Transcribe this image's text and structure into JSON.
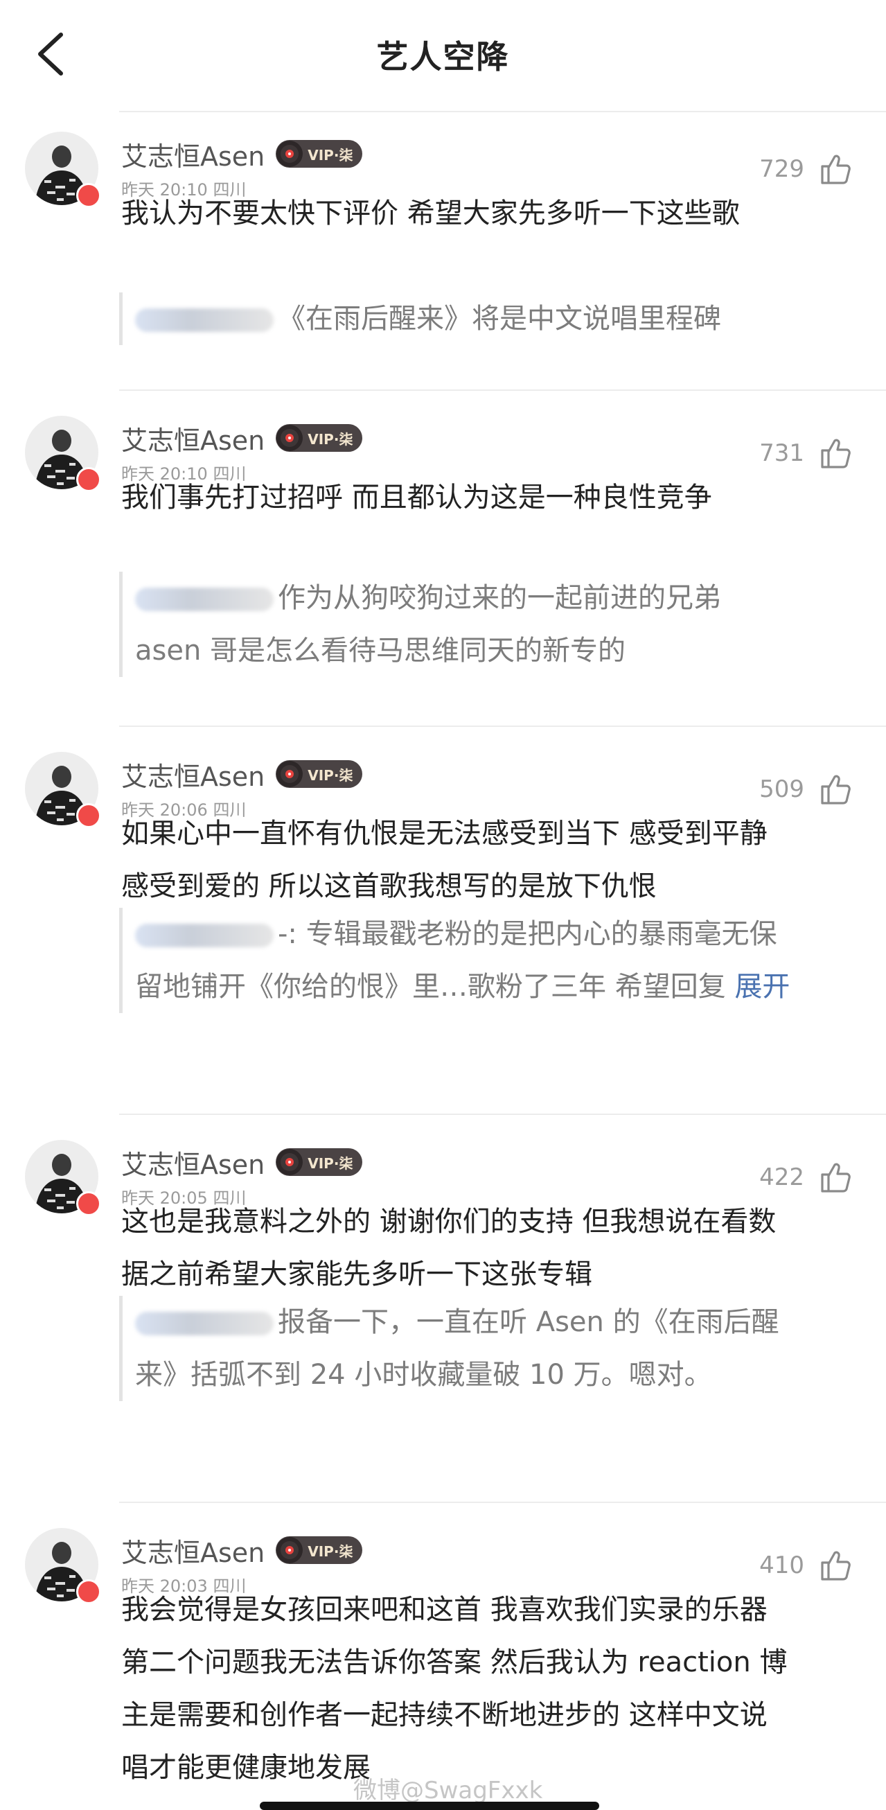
{
  "header": {
    "title": "艺人空降",
    "back_icon": "chevron-left-icon"
  },
  "comments": [
    {
      "author": "艾志恒Asen",
      "vip_label": "VIP·柒",
      "time": "昨天 20:10",
      "location": "四川",
      "likes": "729",
      "text_lines": [
        "我认为不要太快下评价 希望大家先多听一下这些歌"
      ],
      "quote_lines": [
        "《在雨后醒来》将是中文说唱里程碑"
      ],
      "quote_expand": ""
    },
    {
      "author": "艾志恒Asen",
      "vip_label": "VIP·柒",
      "time": "昨天 20:10",
      "location": "四川",
      "likes": "731",
      "text_lines": [
        "我们事先打过招呼 而且都认为这是一种良性竞争"
      ],
      "quote_lines": [
        "作为从狗咬狗过来的一起前进的兄弟",
        "asen 哥是怎么看待马思维同天的新专的"
      ],
      "quote_expand": ""
    },
    {
      "author": "艾志恒Asen",
      "vip_label": "VIP·柒",
      "time": "昨天 20:06",
      "location": "四川",
      "likes": "509",
      "text_lines": [
        "如果心中一直怀有仇恨是无法感受到当下 感受到平静",
        "感受到爱的 所以这首歌我想写的是放下仇恨"
      ],
      "quote_lines": [
        "-: 专辑最戳老粉的是把内心的暴雨毫无保",
        "留地铺开《你给的恨》里…歌粉了三年 希望回复 "
      ],
      "quote_expand": "展开"
    },
    {
      "author": "艾志恒Asen",
      "vip_label": "VIP·柒",
      "time": "昨天 20:05",
      "location": "四川",
      "likes": "422",
      "text_lines": [
        "这也是我意料之外的 谢谢你们的支持 但我想说在看数",
        "据之前希望大家能先多听一下这张专辑"
      ],
      "quote_lines": [
        "报备一下，一直在听 Asen 的《在雨后醒",
        "来》括弧不到 24 小时收藏量破 10 万。嗯对。"
      ],
      "quote_expand": ""
    },
    {
      "author": "艾志恒Asen",
      "vip_label": "VIP·柒",
      "time": "昨天 20:03",
      "location": "四川",
      "likes": "410",
      "text_lines": [
        "我会觉得是女孩回来吧和这首 我喜欢我们实录的乐器",
        "第二个问题我无法告诉你答案 然后我认为 reaction 博",
        "主是需要和创作者一起持续不断地进步的 这样中文说",
        "唱才能更健康地发展"
      ],
      "quote_lines": [],
      "quote_expand": ""
    }
  ],
  "watermark": "微博@SwagFxxk_",
  "colors": {
    "vip_bg": "#4a4344",
    "badge": "#f04a48",
    "link": "#4a72b0"
  }
}
